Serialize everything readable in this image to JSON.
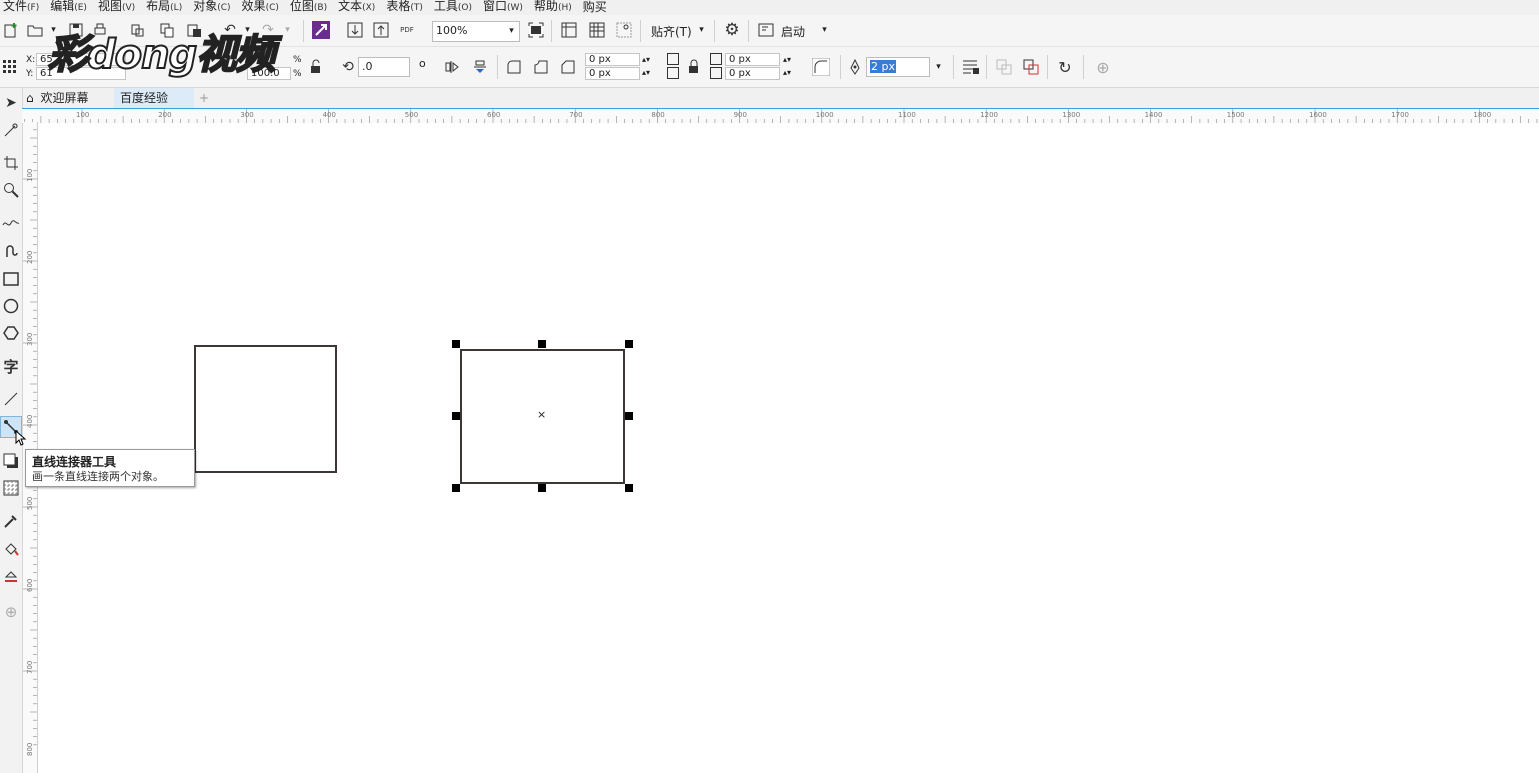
{
  "menu": [
    {
      "label": "文件",
      "acc": "(F)"
    },
    {
      "label": "编辑",
      "acc": "(E)"
    },
    {
      "label": "视图",
      "acc": "(V)"
    },
    {
      "label": "布局",
      "acc": "(L)"
    },
    {
      "label": "对象",
      "acc": "(C)"
    },
    {
      "label": "效果",
      "acc": "(C)"
    },
    {
      "label": "位图",
      "acc": "(B)"
    },
    {
      "label": "文本",
      "acc": "(X)"
    },
    {
      "label": "表格",
      "acc": "(T)"
    },
    {
      "label": "工具",
      "acc": "(O)"
    },
    {
      "label": "窗口",
      "acc": "(W)"
    },
    {
      "label": "帮助",
      "acc": "(H)"
    },
    {
      "label": "购买",
      "acc": ""
    }
  ],
  "toolbar": {
    "pdf_label": "PDF",
    "zoom": "100%",
    "snap_label": "贴齐(T)",
    "launch_label": "启动"
  },
  "props": {
    "x_label": "X:",
    "x_value": "65",
    "y_label": "Y:",
    "y_value": "61",
    "pct1": "%",
    "pct2": "%",
    "scale_value": "100.0",
    "rotation": ".0",
    "degree": "o",
    "corner1": "0 px",
    "corner2": "0 px",
    "corner3": "0 px",
    "corner4": "0 px",
    "outline_width": "2 px"
  },
  "tabs": {
    "welcome": "欢迎屏幕",
    "doc": "百度经验",
    "add": "+"
  },
  "ruler": {
    "h": [
      "100",
      "200",
      "300",
      "400",
      "500",
      "600",
      "700",
      "800",
      "900",
      "1000",
      "1100",
      "1200",
      "1300",
      "1400",
      "1500",
      "1600",
      "1700",
      "1800"
    ],
    "v": [
      "100",
      "200",
      "300",
      "400",
      "500",
      "600",
      "700",
      "800"
    ]
  },
  "tooltip": {
    "title": "直线连接器工具",
    "desc": "画一条直线连接两个对象。"
  },
  "watermark": "彩dong视频",
  "colors": {
    "accent": "#3aa0e0",
    "selection_handle": "#000000",
    "rect_stroke": "#3e3634"
  }
}
